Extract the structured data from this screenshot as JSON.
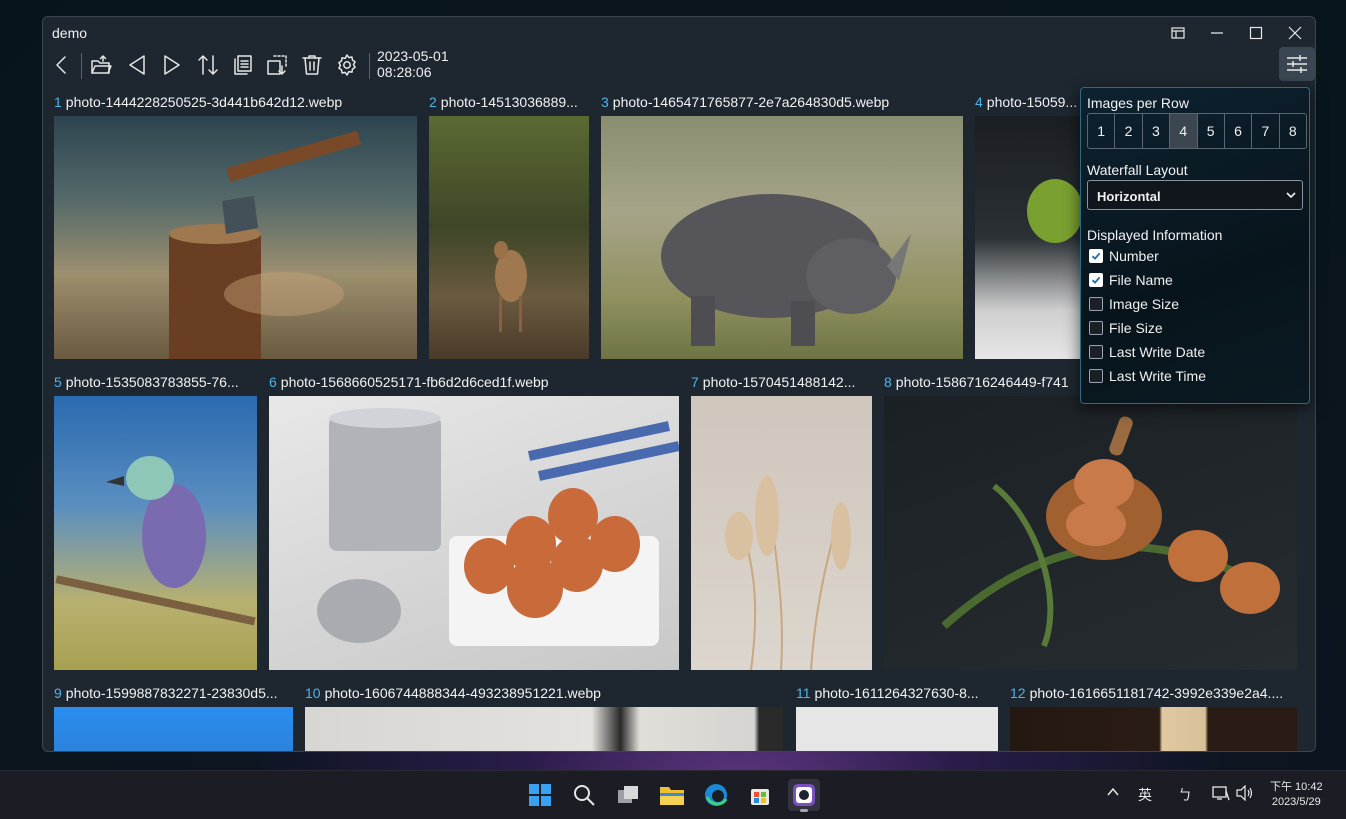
{
  "window": {
    "title": "demo"
  },
  "toolbar": {
    "date": "2023-05-01",
    "time": "08:28:06",
    "buttons": [
      "back-icon",
      "open-folder-icon",
      "previous-icon",
      "next-icon",
      "sort-icon",
      "copy-icon",
      "move-icon",
      "delete-icon",
      "gear-icon"
    ]
  },
  "gallery": {
    "items": [
      {
        "num": "1",
        "name": "photo-1444228250525-3d441b642d12.webp"
      },
      {
        "num": "2",
        "name": "photo-14513036889..."
      },
      {
        "num": "3",
        "name": "photo-1465471765877-2e7a264830d5.webp"
      },
      {
        "num": "4",
        "name": "photo-15059..."
      },
      {
        "num": "5",
        "name": "photo-1535083783855-76..."
      },
      {
        "num": "6",
        "name": "photo-1568660525171-fb6d2d6ced1f.webp"
      },
      {
        "num": "7",
        "name": "photo-1570451488142..."
      },
      {
        "num": "8",
        "name": "photo-1586716246449-f741"
      },
      {
        "num": "9",
        "name": "photo-1599887832271-23830d5..."
      },
      {
        "num": "10",
        "name": "photo-1606744888344-493238951221.webp"
      },
      {
        "num": "11",
        "name": "photo-1611264327630-8..."
      },
      {
        "num": "12",
        "name": "photo-1616651181742-3992e339e2a4...."
      }
    ]
  },
  "settings": {
    "images_per_row_label": "Images per Row",
    "images_per_row_options": [
      "1",
      "2",
      "3",
      "4",
      "5",
      "6",
      "7",
      "8"
    ],
    "images_per_row_selected": "4",
    "waterfall_label": "Waterfall Layout",
    "waterfall_value": "Horizontal",
    "displayed_info_label": "Displayed Information",
    "options": [
      {
        "label": "Number",
        "checked": true
      },
      {
        "label": "File Name",
        "checked": true
      },
      {
        "label": "Image Size",
        "checked": false
      },
      {
        "label": "File Size",
        "checked": false
      },
      {
        "label": "Last Write Date",
        "checked": false
      },
      {
        "label": "Last Write Time",
        "checked": false
      }
    ]
  },
  "taskbar": {
    "ime": "英",
    "ime2": "ㄅ",
    "clock_time": "下午 10:42",
    "clock_date": "2023/5/29"
  },
  "colors": {
    "accent": "#4fb3e8",
    "window_bg": "#1e2730"
  }
}
